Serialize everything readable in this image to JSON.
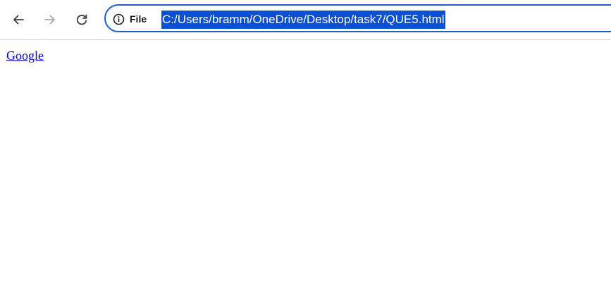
{
  "toolbar": {
    "back_icon": "arrow-left-icon",
    "forward_icon": "arrow-right-icon",
    "reload_icon": "reload-icon",
    "omnibox": {
      "info_icon": "info-icon",
      "scheme_label": "File",
      "url": "C:/Users/bramm/OneDrive/Desktop/task7/QUE5.html",
      "border_color": "#1a5fd0",
      "selection_color": "#0b50d5"
    }
  },
  "page": {
    "link_text": "Google",
    "link_color": "#0000ee"
  }
}
